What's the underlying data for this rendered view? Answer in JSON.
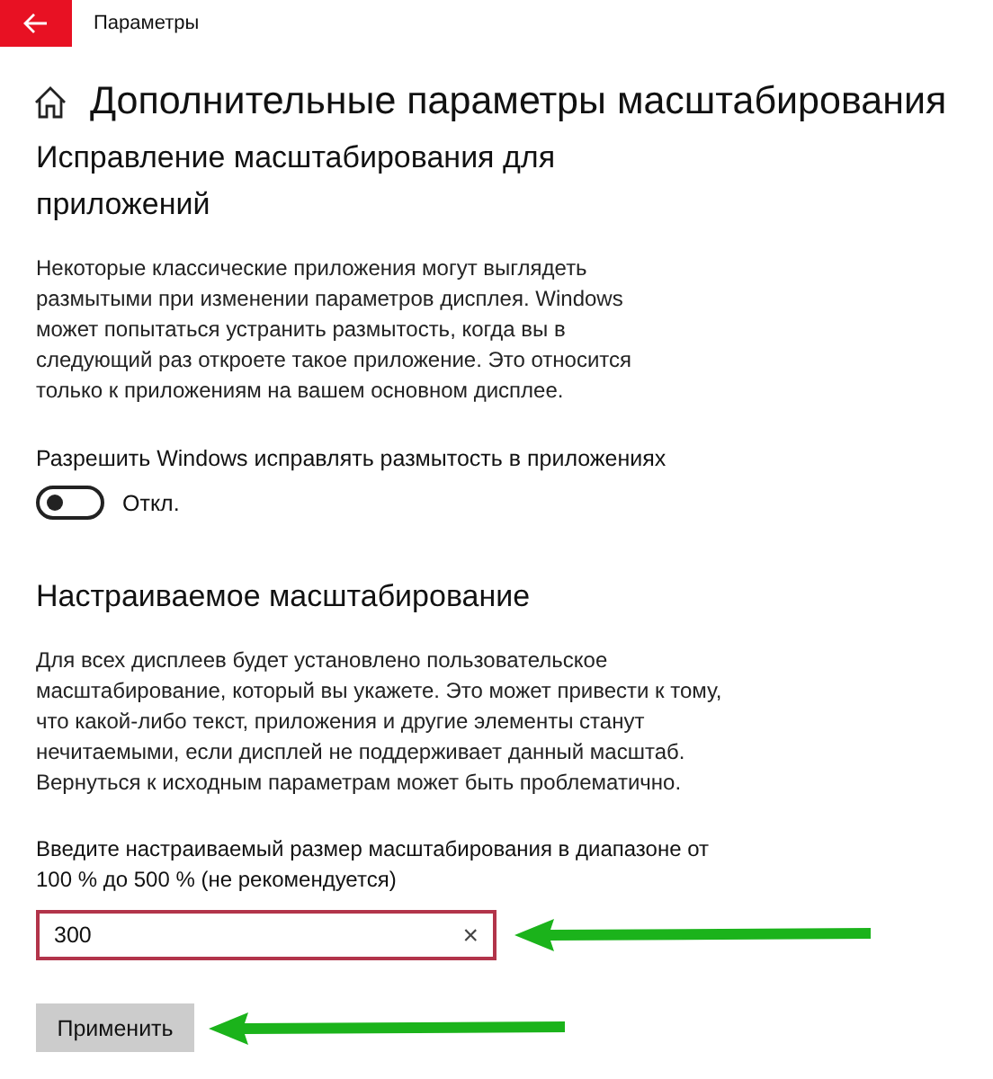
{
  "window": {
    "title": "Параметры"
  },
  "page_title": "Дополнительные параметры масштабирования",
  "fix_section": {
    "heading": "Исправление масштабирования для приложений",
    "description": "Некоторые классические приложения могут выглядеть размытыми при изменении параметров дисплея. Windows может попытаться устранить размытость, когда вы в следующий раз откроете такое приложение. Это относится только к приложениям на вашем основном дисплее.",
    "toggle": {
      "label": "Разрешить Windows исправлять размытость в приложениях",
      "on": false,
      "state_text": "Откл."
    }
  },
  "custom_section": {
    "heading": "Настраиваемое масштабирование",
    "description": "Для всех дисплеев будет установлено пользовательское масштабирование, который вы укажете. Это может привести к тому, что какой-либо текст, приложения и другие элементы станут нечитаемыми, если дисплей не поддерживает данный масштаб. Вернуться к исходным параметрам может быть проблематично.",
    "field_label": "Введите настраиваемый размер масштабирования в диапазоне от 100 % до 500 % (не рекомендуется)",
    "value": "300",
    "clear_icon": "×",
    "button": "Применить"
  }
}
